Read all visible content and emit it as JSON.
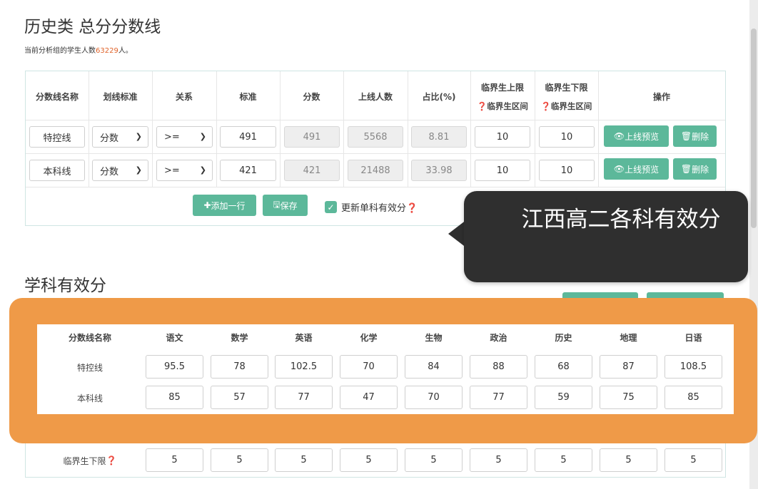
{
  "section1": {
    "title": "历史类 总分分数线",
    "count_prefix": "当前分析组的学生人数",
    "count_value": "63229",
    "count_suffix": "人。",
    "headers": [
      "分数线名称",
      "划线标准",
      "关系",
      "标准",
      "分数",
      "上线人数",
      "占比(%)"
    ],
    "upper_header": "临界生上限",
    "upper_sub": "临界生区间",
    "lower_header": "临界生下限",
    "lower_sub": "临界生区间",
    "ops_header": "操作",
    "rows": [
      {
        "name": "特控线",
        "criterion": "分数",
        "relation": ">=",
        "standard": "491",
        "score": "491",
        "count": "5568",
        "ratio": "8.81",
        "upper": "10",
        "lower": "10"
      },
      {
        "name": "本科线",
        "criterion": "分数",
        "relation": ">=",
        "standard": "421",
        "score": "421",
        "count": "21488",
        "ratio": "33.98",
        "upper": "10",
        "lower": "10"
      }
    ],
    "preview_label": "上线预览",
    "delete_label": "删除",
    "add_row_label": "添加一行",
    "save_label": "保存",
    "update_label": "更新单科有效分"
  },
  "callout": {
    "text": "江西高二各科有效分"
  },
  "section2": {
    "title": "学科有效分",
    "name_header": "分数线名称",
    "subjects": [
      "语文",
      "数学",
      "英语",
      "化学",
      "生物",
      "政治",
      "历史",
      "地理",
      "日语"
    ],
    "rows": [
      {
        "name": "特控线",
        "values": [
          "95.5",
          "78",
          "102.5",
          "70",
          "84",
          "88",
          "68",
          "87",
          "108.5"
        ]
      },
      {
        "name": "本科线",
        "values": [
          "85",
          "57",
          "77",
          "47",
          "70",
          "77",
          "59",
          "75",
          "85"
        ]
      }
    ],
    "lower_label": "临界生下限",
    "lower_values": [
      "5",
      "5",
      "5",
      "5",
      "5",
      "5",
      "5",
      "5",
      "5"
    ]
  },
  "colors": {
    "accent": "#5cb89a",
    "highlight": "#ef9a48",
    "count": "#e0632a",
    "callout": "#2f2f2f"
  }
}
